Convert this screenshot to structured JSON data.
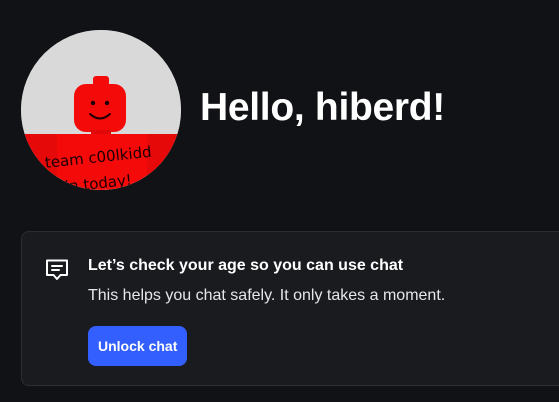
{
  "profile": {
    "greeting": "Hello, hiberd!",
    "avatar_shirt_text": [
      "team c00lkidd",
      "jn today!"
    ],
    "colors": {
      "avatar_bg": "#d9d9d9",
      "avatar_red": "#f50a0a"
    }
  },
  "chat_notice": {
    "icon": "chat-bubble-icon",
    "title": "Let’s check your age so you can use chat",
    "description": "This helps you chat safely. It only takes a moment.",
    "button_label": "Unlock chat",
    "colors": {
      "card_bg": "#191b1f",
      "button_bg": "#335fff"
    }
  }
}
